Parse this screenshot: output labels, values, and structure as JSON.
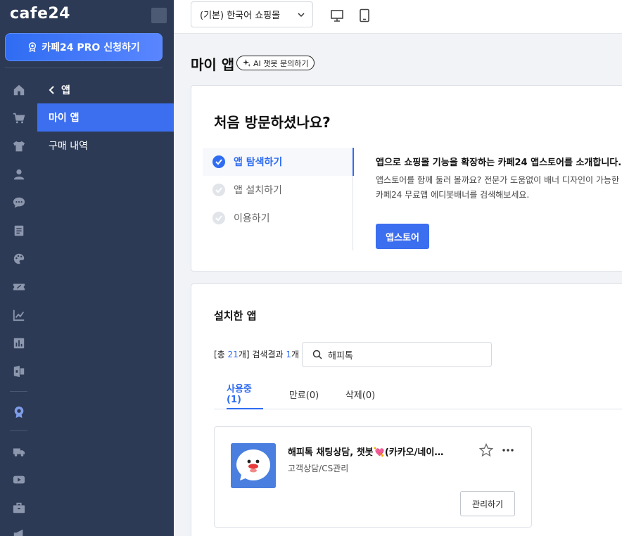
{
  "brand": {
    "logo_text": "cafe24"
  },
  "promo": {
    "label": "카페24 PRO 신청하기"
  },
  "rail_icons": [
    "home-icon",
    "cart-icon",
    "shirt-icon",
    "user-icon",
    "chat-icon",
    "document-icon",
    "palette-icon",
    "coupon-icon",
    "chart-line-icon",
    "chart-bar-icon",
    "app-icon",
    "badge-icon",
    "truck-icon",
    "video-icon",
    "briefcase-icon",
    "megaphone-icon"
  ],
  "submenu": {
    "back_label": "앱",
    "items": [
      {
        "label": "마이 앱",
        "active": true
      },
      {
        "label": "구매 내역",
        "active": false
      }
    ]
  },
  "topbar": {
    "shop_selector": "(기본) 한국어 쇼핑몰"
  },
  "page": {
    "title": "마이 앱",
    "ai_button": "AI 챗봇 문의하기"
  },
  "welcome": {
    "title": "처음 방문하셨나요?",
    "steps": [
      {
        "label": "앱 탐색하기",
        "active": true
      },
      {
        "label": "앱 설치하기",
        "active": false
      },
      {
        "label": "이용하기",
        "active": false
      }
    ],
    "heading": "앱으로 쇼핑몰 기능을 확장하는 카페24 앱스토어를 소개합니다.",
    "description": "앱스토어를 함께 둘러 볼까요? 전문가 도움없이 배너 디자인이 가능한 카페24 무료앱 에디봇배너를 검색해보세요.",
    "button": "앱스토어"
  },
  "installed": {
    "title": "설치한 앱",
    "count_prefix": "[총 ",
    "total": "21",
    "count_mid": "개] 검색결과 ",
    "results": "1",
    "count_suffix": "개",
    "search_value": "해피톡",
    "tabs": [
      {
        "label": "사용중(1)",
        "active": true
      },
      {
        "label": "만료(0)",
        "active": false
      },
      {
        "label": "삭제(0)",
        "active": false
      }
    ],
    "apps": [
      {
        "name": "해피톡 채팅상담, 챗봇💘(카카오/네이버톡톡)",
        "category": "고객상담/CS관리",
        "manage_label": "관리하기"
      }
    ]
  },
  "colors": {
    "sidebar": "#2d3a55",
    "accent": "#3c6ef0",
    "active_text": "#2f6cf2"
  }
}
